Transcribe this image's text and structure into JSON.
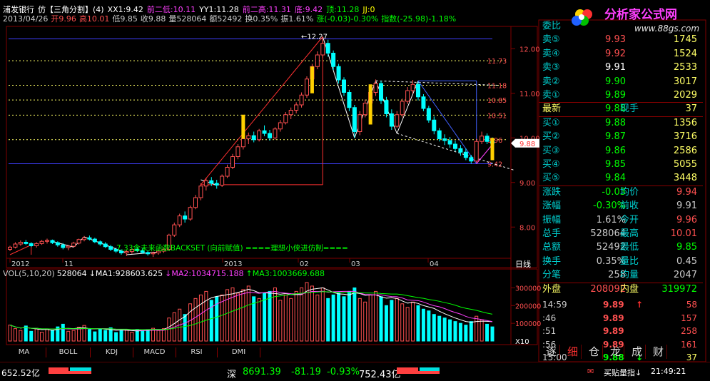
{
  "header": {
    "name": "浦发银行",
    "mode": "仿【三角分割】(4)",
    "xx1": "XX1:9.42",
    "prev_low2": "前二低:10.11",
    "yy1": "YY1:11.28",
    "prev_high2": "前二高:11.31",
    "bottom": "底:9.42",
    "top": "顶:11.28",
    "jj": "JJ:0"
  },
  "ohlc": {
    "date": "2013/04/26",
    "open": "开9.96",
    "high": "高10.01",
    "low": "低9.85",
    "close": "收9.88",
    "volume": "量528064",
    "amount": "额52492",
    "turnover": "换0.35%",
    "amplitude": "振1.61%",
    "change": "涨(-0.03)-0.30%",
    "index": "指数(-25.98)-1.18%"
  },
  "price_axis": [
    "12.00",
    "11.00",
    "10.00",
    "9.00",
    "8.00"
  ],
  "level_labels": [
    "11.73",
    "11.18",
    "10.85",
    "10.51",
    "9.96",
    "9.42"
  ],
  "peak_label": "12.27",
  "current_price_tag": "9.88",
  "annotation": "7.33含未来函数BACKSET (向前赋值) ====理想小侠进仿制====",
  "date_axis": [
    "2012",
    "11",
    "2013",
    "02",
    "03",
    "04"
  ],
  "period_button": "日线",
  "volume_header": {
    "label": "VOL(5,10,20)",
    "vol": "528064",
    "ma1": "↓MA1:928603.625",
    "ma2": "↓MA2:1034715.188",
    "ma3": "↑MA3:1003669.688"
  },
  "volume_axis": [
    "300000",
    "200000",
    "100000"
  ],
  "volume_unit": "X10",
  "indicator_tabs": [
    "MA",
    "BOLL",
    "KDJ",
    "MACD",
    "RSI",
    "DMI"
  ],
  "order_book": [
    {
      "label": "委比",
      "v1": "",
      "v2": ""
    },
    {
      "label": "卖⑤",
      "v1": "9.93",
      "v2": "1745"
    },
    {
      "label": "卖④",
      "v1": "9.92",
      "v2": "1524"
    },
    {
      "label": "卖③",
      "v1": "9.91",
      "v2": "2533"
    },
    {
      "label": "卖②",
      "v1": "9.90",
      "v2": "3017"
    },
    {
      "label": "卖①",
      "v1": "9.89",
      "v2": "2029"
    },
    {
      "label": "最新",
      "v1": "9.88",
      "label2": "现手",
      "v2": "37"
    },
    {
      "label": "买①",
      "v1": "9.88",
      "v2": "1356"
    },
    {
      "label": "买②",
      "v1": "9.87",
      "v2": "3716"
    },
    {
      "label": "买③",
      "v1": "9.86",
      "v2": "2586"
    },
    {
      "label": "买④",
      "v1": "9.85",
      "v2": "5055"
    },
    {
      "label": "买⑤",
      "v1": "9.84",
      "v2": "3448"
    },
    {
      "label": "涨跌",
      "v1": "-0.03",
      "label2": "均价",
      "v2": "9.94"
    },
    {
      "label": "涨幅",
      "v1": "-0.30%",
      "label2": "前收",
      "v2": "9.91"
    },
    {
      "label": "振幅",
      "v1": "1.61%",
      "label2": "今开",
      "v2": "9.96"
    },
    {
      "label": "总手",
      "v1": "528064",
      "label2": "最高",
      "v2": "10.01"
    },
    {
      "label": "总额",
      "v1": "52492",
      "label2": "最低",
      "v2": "9.85"
    },
    {
      "label": "换手",
      "v1": "0.35%",
      "label2": "量比",
      "v2": "0.45"
    },
    {
      "label": "分笔",
      "v1": "258",
      "label2": "均量",
      "v2": "2047"
    },
    {
      "label": "外盘",
      "v1": "208092",
      "label2": "内盘",
      "v2": "319972"
    }
  ],
  "ticks": [
    {
      "t": "14:59",
      "p": "9.89",
      "ar": "↑",
      "q": "58"
    },
    {
      "t": ":46",
      "p": "9.89",
      "ar": "",
      "q": "157"
    },
    {
      "t": ":51",
      "p": "9.89",
      "ar": "",
      "q": "258"
    },
    {
      "t": ":56",
      "p": "9.89",
      "ar": "",
      "q": "161"
    },
    {
      "t": "15:00",
      "p": "9.88",
      "ar": "↓",
      "q": "37"
    }
  ],
  "right_tabs": [
    "逐",
    "细",
    "仓",
    "龙",
    "成",
    "财"
  ],
  "status": {
    "sh_amount": "652.52亿",
    "sz_label": "深",
    "sz_index": "8691.39",
    "sz_change": "-81.19",
    "sz_pct": "-0.93%",
    "sz_amount": "752.43亿",
    "indicator_text": "买贴量指↓",
    "time": "21:49:21"
  },
  "logo": {
    "title": "分析家公式网",
    "url": "www.88gs.com"
  },
  "colors": {
    "up": "#ff5050",
    "down": "#00ffff",
    "level": "#ffff66",
    "box": "#4040ff",
    "grid": "#800000"
  },
  "chart_data": [
    {
      "type": "candlestick",
      "x": [
        "2012-10",
        "2012-11",
        "2012-12",
        "2013-01",
        "2013-02",
        "2013-03",
        "2013-04"
      ],
      "ylim": [
        7.3,
        12.5
      ],
      "annotated_levels": [
        12.27,
        11.73,
        11.18,
        10.85,
        10.51,
        9.96,
        9.42,
        9.88
      ],
      "last": {
        "date": "2013/04/26",
        "open": 9.96,
        "high": 10.01,
        "low": 9.85,
        "close": 9.88
      },
      "candles": [
        [
          7.5,
          7.58,
          7.46,
          7.55
        ],
        [
          7.55,
          7.66,
          7.52,
          7.62
        ],
        [
          7.62,
          7.7,
          7.58,
          7.66
        ],
        [
          7.66,
          7.71,
          7.6,
          7.63
        ],
        [
          7.63,
          7.66,
          7.55,
          7.58
        ],
        [
          7.58,
          7.66,
          7.54,
          7.63
        ],
        [
          7.63,
          7.71,
          7.6,
          7.68
        ],
        [
          7.68,
          7.74,
          7.63,
          7.7
        ],
        [
          7.7,
          7.72,
          7.62,
          7.65
        ],
        [
          7.65,
          7.68,
          7.56,
          7.6
        ],
        [
          7.6,
          7.64,
          7.5,
          7.54
        ],
        [
          7.54,
          7.6,
          7.48,
          7.57
        ],
        [
          7.57,
          7.67,
          7.55,
          7.64
        ],
        [
          7.64,
          7.74,
          7.61,
          7.72
        ],
        [
          7.72,
          7.8,
          7.68,
          7.76
        ],
        [
          7.76,
          7.81,
          7.7,
          7.73
        ],
        [
          7.73,
          7.76,
          7.64,
          7.67
        ],
        [
          7.67,
          7.7,
          7.58,
          7.62
        ],
        [
          7.62,
          7.66,
          7.53,
          7.56
        ],
        [
          7.56,
          7.6,
          7.46,
          7.5
        ],
        [
          7.5,
          7.54,
          7.42,
          7.46
        ],
        [
          7.46,
          7.5,
          7.38,
          7.42
        ],
        [
          7.42,
          7.48,
          7.35,
          7.45
        ],
        [
          7.45,
          7.53,
          7.4,
          7.5
        ],
        [
          7.5,
          7.56,
          7.44,
          7.47
        ],
        [
          7.47,
          7.52,
          7.4,
          7.43
        ],
        [
          7.43,
          7.47,
          7.36,
          7.4
        ],
        [
          7.4,
          7.45,
          7.33,
          7.42
        ],
        [
          7.42,
          7.5,
          7.38,
          7.46
        ],
        [
          7.46,
          7.54,
          7.42,
          7.5
        ],
        [
          7.5,
          7.85,
          7.46,
          7.82
        ],
        [
          7.82,
          8.1,
          7.78,
          8.05
        ],
        [
          8.05,
          8.3,
          8.0,
          8.25
        ],
        [
          8.25,
          8.35,
          8.1,
          8.18
        ],
        [
          8.18,
          8.48,
          8.14,
          8.44
        ],
        [
          8.44,
          8.72,
          8.4,
          8.66
        ],
        [
          8.66,
          8.98,
          8.6,
          8.92
        ],
        [
          8.92,
          9.1,
          8.82,
          9.04
        ],
        [
          9.04,
          9.12,
          8.92,
          8.98
        ],
        [
          8.98,
          9.06,
          8.86,
          8.94
        ],
        [
          8.94,
          9.18,
          8.9,
          9.14
        ],
        [
          9.14,
          9.4,
          9.1,
          9.34
        ],
        [
          9.34,
          9.64,
          9.3,
          9.58
        ],
        [
          9.58,
          9.86,
          9.52,
          9.8
        ],
        [
          9.8,
          10.08,
          9.74,
          9.98
        ],
        [
          9.98,
          10.12,
          9.86,
          10.05
        ],
        [
          10.05,
          10.14,
          9.9,
          9.96
        ],
        [
          9.96,
          10.2,
          9.92,
          10.16
        ],
        [
          10.16,
          10.28,
          10.04,
          10.1
        ],
        [
          10.1,
          10.18,
          9.94,
          10.0
        ],
        [
          10.0,
          10.24,
          9.96,
          10.2
        ],
        [
          10.2,
          10.4,
          10.14,
          10.34
        ],
        [
          10.34,
          10.58,
          10.3,
          10.52
        ],
        [
          10.52,
          10.68,
          10.42,
          10.62
        ],
        [
          10.62,
          10.8,
          10.55,
          10.74
        ],
        [
          10.74,
          11.02,
          10.68,
          10.96
        ],
        [
          10.96,
          11.38,
          10.9,
          11.32
        ],
        [
          11.32,
          11.66,
          11.26,
          11.6
        ],
        [
          11.6,
          11.94,
          11.54,
          11.86
        ],
        [
          11.86,
          12.27,
          11.8,
          12.12
        ],
        [
          12.12,
          12.2,
          11.82,
          11.9
        ],
        [
          11.9,
          11.96,
          11.52,
          11.6
        ],
        [
          11.6,
          11.66,
          11.22,
          11.3
        ],
        [
          11.3,
          11.36,
          10.94,
          11.02
        ],
        [
          11.02,
          11.08,
          10.6,
          10.68
        ],
        [
          10.68,
          10.74,
          10.0,
          10.14
        ],
        [
          10.14,
          10.6,
          10.06,
          10.52
        ],
        [
          10.52,
          10.86,
          10.46,
          10.78
        ],
        [
          10.78,
          11.1,
          10.7,
          11.02
        ],
        [
          11.02,
          11.31,
          10.94,
          11.22
        ],
        [
          11.22,
          11.28,
          10.76,
          10.84
        ],
        [
          10.84,
          10.92,
          10.46,
          10.54
        ],
        [
          10.54,
          10.64,
          10.18,
          10.26
        ],
        [
          10.26,
          10.6,
          10.22,
          10.52
        ],
        [
          10.52,
          10.88,
          10.46,
          10.82
        ],
        [
          10.82,
          11.14,
          10.76,
          11.06
        ],
        [
          11.06,
          11.3,
          11.0,
          11.2
        ],
        [
          11.2,
          11.26,
          10.84,
          10.92
        ],
        [
          10.92,
          10.98,
          10.6,
          10.66
        ],
        [
          10.66,
          10.72,
          10.34,
          10.4
        ],
        [
          10.4,
          10.48,
          10.08,
          10.16
        ],
        [
          10.16,
          10.22,
          9.92,
          9.98
        ],
        [
          9.98,
          10.08,
          9.84,
          9.94
        ],
        [
          9.94,
          10.02,
          9.78,
          9.86
        ],
        [
          9.86,
          9.94,
          9.7,
          9.76
        ],
        [
          9.76,
          9.84,
          9.6,
          9.68
        ],
        [
          9.68,
          9.76,
          9.5,
          9.56
        ],
        [
          9.56,
          9.62,
          9.42,
          9.48
        ],
        [
          9.48,
          9.98,
          9.44,
          9.92
        ],
        [
          9.92,
          10.14,
          9.86,
          10.04
        ],
        [
          10.04,
          10.1,
          9.86,
          9.92
        ],
        [
          9.92,
          10.01,
          9.85,
          9.88
        ]
      ]
    },
    {
      "type": "bar",
      "ylim": [
        0,
        350000
      ],
      "values": [
        90000,
        70000,
        60000,
        85000,
        55000,
        72000,
        50000,
        68000,
        60000,
        80000,
        95000,
        55000,
        60000,
        78000,
        88000,
        65000,
        52000,
        70000,
        60000,
        75000,
        48000,
        58000,
        62000,
        50000,
        66000,
        58000,
        64000,
        72000,
        60000,
        70000,
        130000,
        160000,
        180000,
        150000,
        210000,
        240000,
        260000,
        280000,
        230000,
        250000,
        260000,
        290000,
        300000,
        270000,
        290000,
        310000,
        250000,
        240000,
        270000,
        280000,
        300000,
        230000,
        260000,
        240000,
        280000,
        300000,
        330000,
        310000,
        260000,
        300000,
        240000,
        260000,
        270000,
        250000,
        280000,
        300000,
        240000,
        220000,
        260000,
        280000,
        250000,
        200000,
        230000,
        240000,
        210000,
        190000,
        220000,
        200000,
        180000,
        170000,
        150000,
        140000,
        130000,
        120000,
        110000,
        100000,
        90000,
        110000,
        140000,
        120000,
        95000,
        80000
      ],
      "ma": {
        "ma1": 928603.625,
        "ma2": 1034715.188,
        "ma3": 1003669.688
      }
    }
  ]
}
